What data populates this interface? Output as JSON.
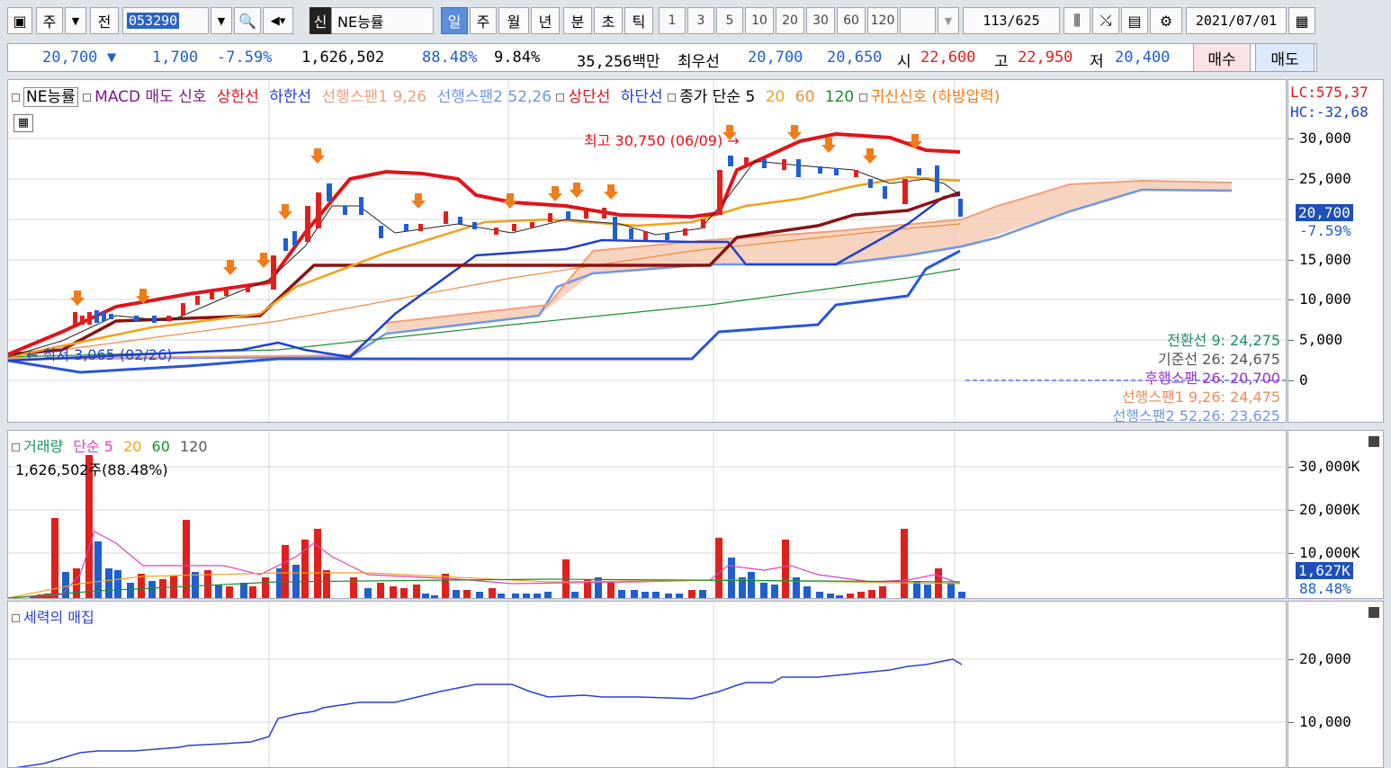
{
  "toolbar": {
    "stock_type": "주",
    "prev_label": "전",
    "code": "053290",
    "credit_badge": "신",
    "name": "NE능률",
    "periods": [
      "일",
      "주",
      "월",
      "년",
      "분",
      "초",
      "틱"
    ],
    "active_period": "일",
    "intervals": [
      "1",
      "3",
      "5",
      "10",
      "20",
      "30",
      "60",
      "120"
    ],
    "count": "113",
    "total": "/625",
    "date": "2021/07/01"
  },
  "quote": {
    "price": "20,700",
    "direction": "▼",
    "change": "1,700",
    "change_pct": "-7.59%",
    "volume": "1,626,502",
    "vol_ratio": "88.48%",
    "turnover": "9.84%",
    "amount": "35,256백만",
    "best_label": "최우선",
    "ask": "20,700",
    "bid": "20,650",
    "open_label": "시",
    "open": "22,600",
    "high_label": "고",
    "high": "22,950",
    "low_label": "저",
    "low": "20,400",
    "buy_label": "매수",
    "sell_label": "매도"
  },
  "price_pane": {
    "legend": {
      "name": "NE능률",
      "macd": "MACD 매도 신호",
      "upper": "상한선",
      "lower": "하한선",
      "span1": "선행스팬1 9,26",
      "span2": "선행스팬2 52,26",
      "top": "상단선",
      "bottom": "하단선",
      "ma": "종가 단순 5",
      "ma20": "20",
      "ma60": "60",
      "ma120": "120",
      "signal": "귀신신호 (하방압력)"
    },
    "lc": "LC:575,37",
    "hc": "HC:-32,68",
    "high_note": "최고 30,750 (06/09) →",
    "low_note": "← 최저 3,065 (02/26)",
    "ichimoku": {
      "conversion": "전환선 9: 24,275",
      "base": "기준선 26: 24,675",
      "lagging": "후행스팬 26: 20,700",
      "span1": "선행스팬1 9,26: 24,475",
      "span2": "선행스팬2 52,26: 23,625"
    },
    "axis": [
      "30,000",
      "25,000",
      "20,000",
      "15,000",
      "10,000",
      "5,000",
      "0"
    ],
    "cur_price": "20,700",
    "cur_pct": "-7.59%"
  },
  "volume_pane": {
    "legend": {
      "name": "거래량",
      "ma": "단순 5",
      "ma20": "20",
      "ma60": "60",
      "ma120": "120"
    },
    "current": "1,626,502주(88.48%)",
    "axis": [
      "30,000K",
      "20,000K",
      "10,000K"
    ],
    "cur_vol": "1,627K",
    "cur_pct": "88.48%"
  },
  "force_pane": {
    "legend": "세력의 매집",
    "axis": [
      "20,000",
      "10,000"
    ]
  },
  "colors": {
    "up": "#e0201c",
    "down": "#1f5fcf",
    "accent": "#5b8fd8"
  }
}
